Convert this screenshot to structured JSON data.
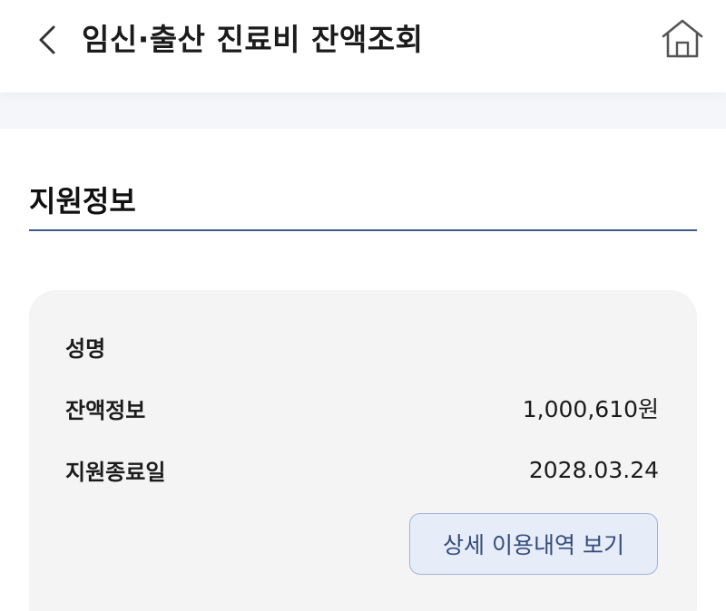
{
  "header": {
    "title": "임신·출산 진료비 잔액조회",
    "back_icon": "chevron-left-icon",
    "home_icon": "home-icon"
  },
  "section": {
    "title": "지원정보",
    "divider_color": "#3f5a8a"
  },
  "info": {
    "rows": [
      {
        "label": "성명",
        "value": ""
      },
      {
        "label": "잔액정보",
        "value": "1,000,610원"
      },
      {
        "label": "지원종료일",
        "value": "2028.03.24"
      }
    ],
    "detail_button_label": "상세 이용내역 보기"
  },
  "colors": {
    "accent": "#354b7a",
    "button_bg": "#e6edf8",
    "card_bg": "#f4f4f5"
  }
}
